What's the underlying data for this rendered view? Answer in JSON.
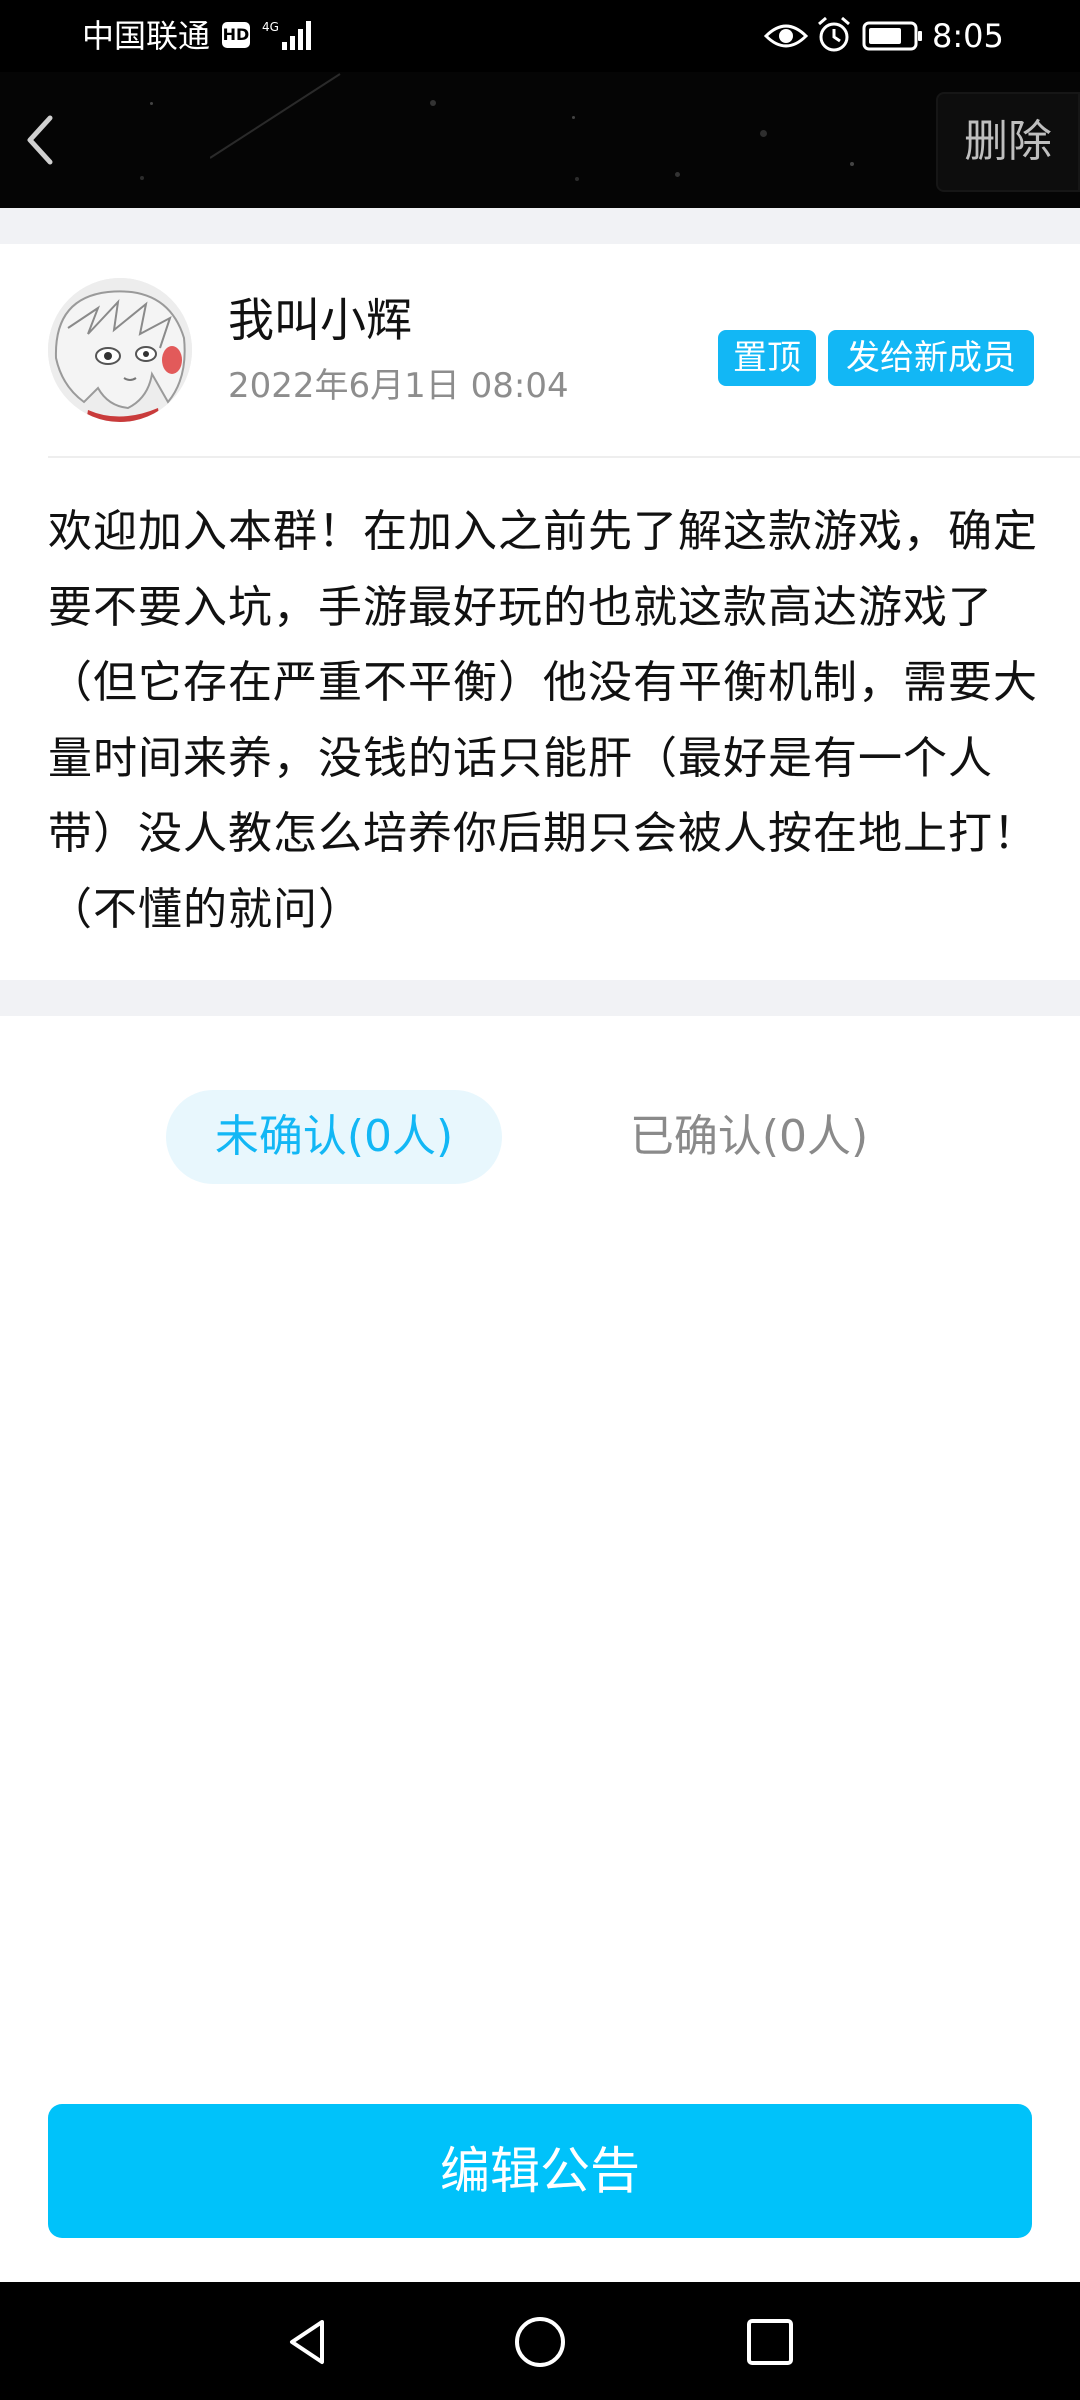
{
  "status_bar": {
    "carrier": "中国联通",
    "hd_badge": "HD",
    "time": "8:05",
    "icons": [
      "hd-icon",
      "signal-4g-icon",
      "eye-icon",
      "alarm-icon",
      "battery-icon"
    ]
  },
  "title_bar": {
    "back_icon": "back-icon",
    "delete_label": "删除"
  },
  "announcement": {
    "author_name": "我叫小辉",
    "date": "2022年6月1日 08:04",
    "tags": {
      "pin": "置顶",
      "send_new": "发给新成员"
    },
    "content": "欢迎加入本群！在加入之前先了解这款游戏，确定要不要入坑，手游最好玩的也就这款高达游戏了（但它存在严重不平衡）他没有平衡机制，需要大量时间来养，没钱的话只能肝（最好是有一个人带）没人教怎么培养你后期只会被人按在地上打！（不懂的就问）"
  },
  "tabs": {
    "unconfirmed": "未确认(0人)",
    "confirmed": "已确认(0人)",
    "selected": "unconfirmed"
  },
  "edit_button_label": "编辑公告",
  "nav_bar": {
    "icons": [
      "nav-back-icon",
      "nav-home-icon",
      "nav-recent-icon"
    ]
  },
  "colors": {
    "accent": "#12b7f5",
    "button": "#00c2fa",
    "tab_selected_bg": "#e8f7fd",
    "page_gap": "#f1f2f5"
  }
}
